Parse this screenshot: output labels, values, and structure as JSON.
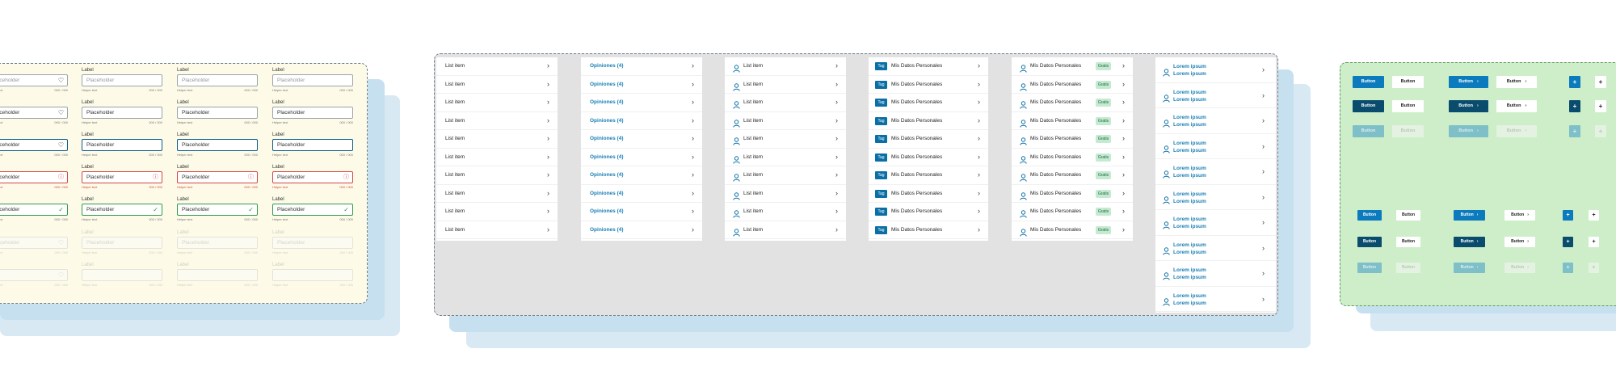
{
  "input_panel": {
    "label": "Label",
    "placeholder": "Placeholder",
    "helper": "Helper text",
    "counter": "000 / 000",
    "icons": {
      "default": "heart-icon",
      "error": "error-circle-icon",
      "success": "check-icon"
    }
  },
  "lists": {
    "plain_item": "List item",
    "opinion_item": "Opiniones (4)",
    "tag_label": "Tag",
    "personal_data": "Mis Datos Personales",
    "gratis_badge": "Gratis",
    "lorem": "Lorem ipsum",
    "chevron": "chevron-right-icon",
    "user_icon": "user-icon"
  },
  "buttons_panel": {
    "button_label": "Button",
    "plus_symbol": "+",
    "chevron_symbol": "›"
  },
  "colors": {
    "primary": "#0b7bbd",
    "primary_dark": "#0a4c6e",
    "link": "#1a7fb5",
    "error": "#d64545",
    "success": "#2e9a4b",
    "tag_bg": "#0a6fa6",
    "gratis_bg": "#c5ead2",
    "green_frame": "#cdeec9",
    "yellow_frame": "#fdfbe8",
    "shadow_blue": "#c6e0f0"
  }
}
